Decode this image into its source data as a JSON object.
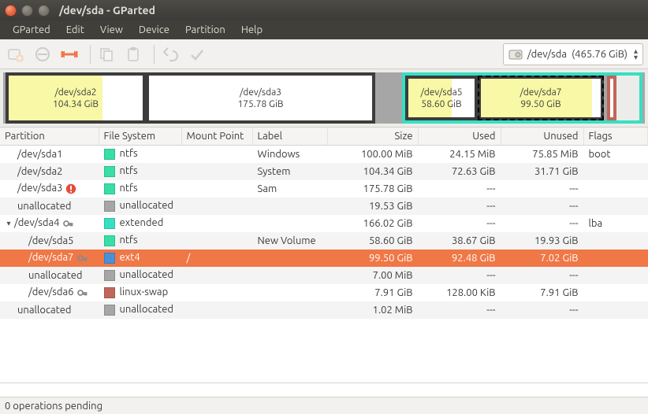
{
  "window": {
    "title": "/dev/sda - GParted"
  },
  "menu": {
    "gparted": "GParted",
    "edit": "Edit",
    "view": "View",
    "device": "Device",
    "partition": "Partition",
    "help": "Help"
  },
  "device": {
    "path": "/dev/sda",
    "size": "(465.76 GiB)"
  },
  "map": {
    "sda2": {
      "name": "/dev/sda2",
      "size": "104.34 GiB"
    },
    "sda3": {
      "name": "/dev/sda3",
      "size": "175.78 GiB"
    },
    "sda5": {
      "name": "/dev/sda5",
      "size": "58.60 GiB"
    },
    "sda7": {
      "name": "/dev/sda7",
      "size": "99.50 GiB"
    }
  },
  "headers": {
    "partition": "Partition",
    "fs": "File System",
    "mount": "Mount Point",
    "label": "Label",
    "size": "Size",
    "used": "Used",
    "unused": "Unused",
    "flags": "Flags"
  },
  "rows": [
    {
      "partition": "/dev/sda1",
      "icons": [],
      "fs": "ntfs",
      "fs_class": "fs-ntfs",
      "mount": "",
      "label": "Windows",
      "size": "100.00 MiB",
      "used": "24.15 MiB",
      "unused": "75.85 MiB",
      "flags": "boot",
      "indent": 1,
      "selected": false,
      "expander": ""
    },
    {
      "partition": "/dev/sda2",
      "icons": [],
      "fs": "ntfs",
      "fs_class": "fs-ntfs",
      "mount": "",
      "label": "System",
      "size": "104.34 GiB",
      "used": "72.63 GiB",
      "unused": "31.71 GiB",
      "flags": "",
      "indent": 1,
      "selected": false,
      "expander": ""
    },
    {
      "partition": "/dev/sda3",
      "icons": [
        "warn"
      ],
      "fs": "ntfs",
      "fs_class": "fs-ntfs",
      "mount": "",
      "label": "Sam",
      "size": "175.78 GiB",
      "used": "---",
      "unused": "---",
      "flags": "",
      "indent": 1,
      "selected": false,
      "expander": ""
    },
    {
      "partition": "unallocated",
      "icons": [],
      "fs": "unallocated",
      "fs_class": "fs-unallocated",
      "mount": "",
      "label": "",
      "size": "19.53 GiB",
      "used": "---",
      "unused": "---",
      "flags": "",
      "indent": 1,
      "selected": false,
      "expander": ""
    },
    {
      "partition": "/dev/sda4",
      "icons": [
        "key"
      ],
      "fs": "extended",
      "fs_class": "fs-extended",
      "mount": "",
      "label": "",
      "size": "166.02 GiB",
      "used": "---",
      "unused": "---",
      "flags": "lba",
      "indent": 0,
      "selected": false,
      "expander": "▾"
    },
    {
      "partition": "/dev/sda5",
      "icons": [],
      "fs": "ntfs",
      "fs_class": "fs-ntfs",
      "mount": "",
      "label": "New Volume",
      "size": "58.60 GiB",
      "used": "38.67 GiB",
      "unused": "19.93 GiB",
      "flags": "",
      "indent": 2,
      "selected": false,
      "expander": ""
    },
    {
      "partition": "/dev/sda7",
      "icons": [
        "key"
      ],
      "fs": "ext4",
      "fs_class": "fs-ext4",
      "mount": "/",
      "label": "",
      "size": "99.50 GiB",
      "used": "92.48 GiB",
      "unused": "7.02 GiB",
      "flags": "",
      "indent": 2,
      "selected": true,
      "expander": ""
    },
    {
      "partition": "unallocated",
      "icons": [],
      "fs": "unallocated",
      "fs_class": "fs-unallocated",
      "mount": "",
      "label": "",
      "size": "7.00 MiB",
      "used": "---",
      "unused": "---",
      "flags": "",
      "indent": 2,
      "selected": false,
      "expander": ""
    },
    {
      "partition": "/dev/sda6",
      "icons": [
        "key"
      ],
      "fs": "linux-swap",
      "fs_class": "fs-swap",
      "mount": "",
      "label": "",
      "size": "7.91 GiB",
      "used": "128.00 KiB",
      "unused": "7.91 GiB",
      "flags": "",
      "indent": 2,
      "selected": false,
      "expander": ""
    },
    {
      "partition": "unallocated",
      "icons": [],
      "fs": "unallocated",
      "fs_class": "fs-unallocated",
      "mount": "",
      "label": "",
      "size": "1.02 MiB",
      "used": "---",
      "unused": "---",
      "flags": "",
      "indent": 1,
      "selected": false,
      "expander": ""
    }
  ],
  "status": {
    "pending": "0 operations pending"
  }
}
